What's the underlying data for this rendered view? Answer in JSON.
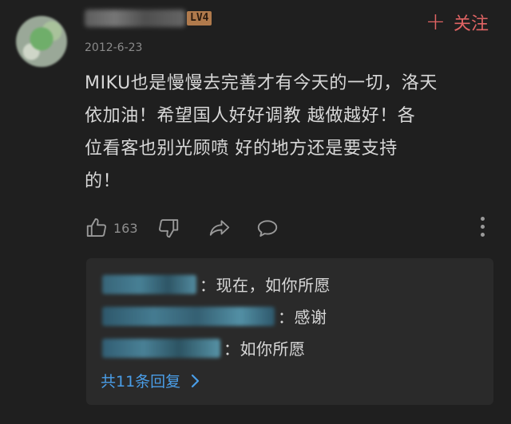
{
  "post": {
    "level_badge": "LV4",
    "follow_label": "关注",
    "follow_icon": "plus-icon",
    "date": "2012-6-23",
    "comment_lines": [
      "MIKU也是慢慢去完善才有今天的一切，洛天",
      "依加油！希望国人好好调教 越做越好！各",
      "位看客也别光顾喷 好的地方还是要支持",
      "的！"
    ],
    "like_count": "163",
    "accent_color": "#e06464",
    "link_color": "#4a9ee8"
  },
  "replies": {
    "items": [
      {
        "text": "：现在，如你所愿"
      },
      {
        "text": "：感谢"
      },
      {
        "text": "：如你所愿"
      }
    ],
    "total_label": "共11条回复"
  }
}
